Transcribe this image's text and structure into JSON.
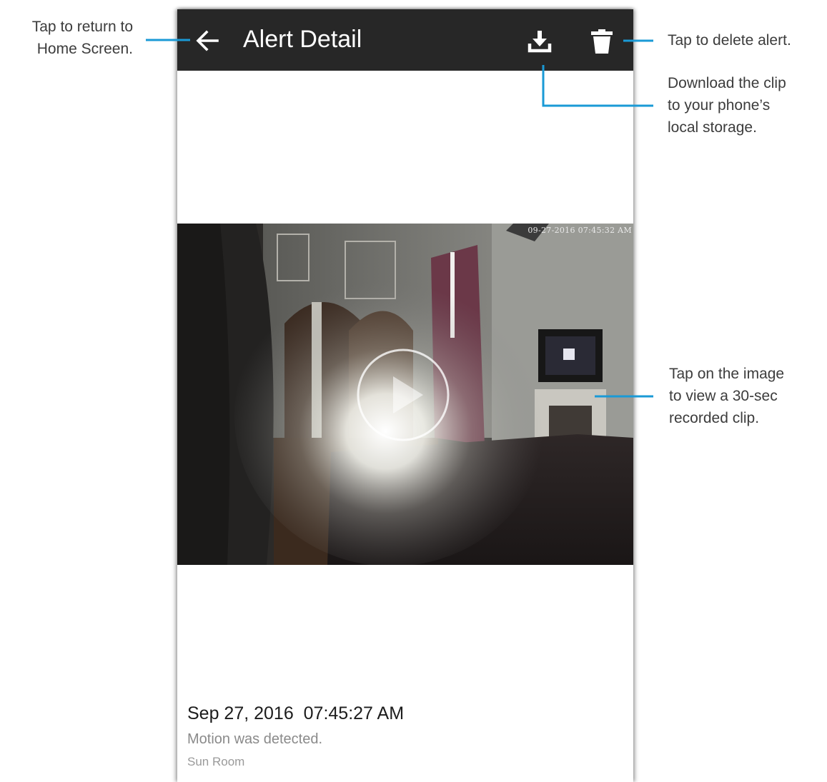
{
  "app_bar": {
    "title": "Alert Detail",
    "background": "#272727",
    "back_icon": "arrow-left-icon",
    "download_icon": "download-icon",
    "delete_icon": "trash-icon"
  },
  "video": {
    "overlay_timestamp": "09-27-2016 07:45:32 AM",
    "play_icon": "play-circle-icon"
  },
  "alert": {
    "datetime": "Sep 27, 2016  07:45:27 AM",
    "message": "Motion was detected.",
    "camera": "Sun Room"
  },
  "callouts": {
    "back": [
      "Tap to return to",
      "Home Screen."
    ],
    "delete": [
      "Tap to delete alert."
    ],
    "download": [
      "Download the clip",
      "to your phone’s",
      "local storage."
    ],
    "play": [
      "Tap on the image",
      "to view a 30-sec",
      "recorded clip."
    ]
  },
  "colors": {
    "callout_line": "#1a9ad6",
    "text_primary": "#1c1c1c",
    "text_secondary": "#8a8a8a"
  }
}
